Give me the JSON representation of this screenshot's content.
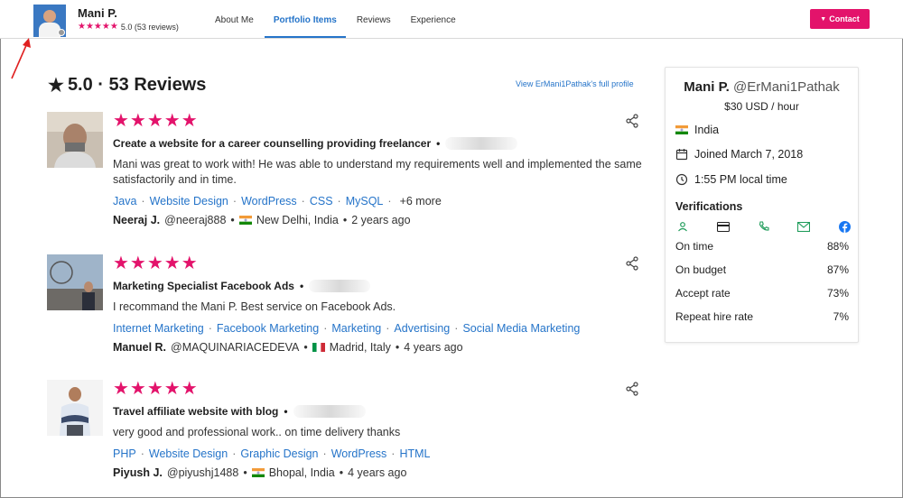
{
  "header": {
    "name": "Mani P.",
    "stars": "★★★★★",
    "rating_text": "5.0 (53 reviews)",
    "nav": [
      "About Me",
      "Portfolio Items",
      "Reviews",
      "Experience"
    ],
    "active_nav": "Portfolio Items",
    "contact_label": "Contact"
  },
  "reviews_section": {
    "rating": "5.0",
    "title": "5.0 · 53 Reviews",
    "full_profile_link": "View ErMani1Pathak's full profile"
  },
  "reviews": [
    {
      "stars": "★★★★★",
      "job": "Create a website for a career counselling providing freelancer",
      "text": "Mani was great to work with! He was able to understand my requirements well and implemented the same satisfactorily and in time.",
      "tags": [
        "Java",
        "Website Design",
        "WordPress",
        "CSS",
        "MySQL"
      ],
      "more": "+6 more",
      "reviewer": "Neeraj J.",
      "handle": "@neeraj888",
      "location": "New Delhi, India",
      "time": "2 years ago",
      "flag": "india"
    },
    {
      "stars": "★★★★★",
      "job": "Marketing Specialist Facebook Ads",
      "text": "I recommand the Mani P. Best service on Facebook Ads.",
      "tags": [
        "Internet Marketing",
        "Facebook Marketing",
        "Marketing",
        "Advertising",
        "Social Media Marketing"
      ],
      "more": "",
      "reviewer": "Manuel R.",
      "handle": "@MAQUINARIACEDEVA",
      "location": "Madrid, Italy",
      "time": "4 years ago",
      "flag": "italy"
    },
    {
      "stars": "★★★★★",
      "job": "Travel affiliate website with blog",
      "text": "very good and professional work.. on time delivery thanks",
      "tags": [
        "PHP",
        "Website Design",
        "Graphic Design",
        "WordPress",
        "HTML"
      ],
      "more": "",
      "reviewer": "Piyush J.",
      "handle": "@piyushj1488",
      "location": "Bhopal, India",
      "time": "4 years ago",
      "flag": "india"
    }
  ],
  "sidebar": {
    "name": "Mani P.",
    "handle": "@ErMani1Pathak",
    "rate": "$30 USD / hour",
    "country": "India",
    "joined": "Joined March 7, 2018",
    "local_time": "1:55 PM local time",
    "verifications_title": "Verifications",
    "stats": [
      {
        "label": "On time",
        "value": "88%"
      },
      {
        "label": "On budget",
        "value": "87%"
      },
      {
        "label": "Accept rate",
        "value": "73%"
      },
      {
        "label": "Repeat hire rate",
        "value": "7%"
      }
    ]
  },
  "colors": {
    "accent_pink": "#e3136b",
    "link_blue": "#2574c9",
    "verify_green": "#1f9c5a",
    "facebook_blue": "#1877f2"
  }
}
